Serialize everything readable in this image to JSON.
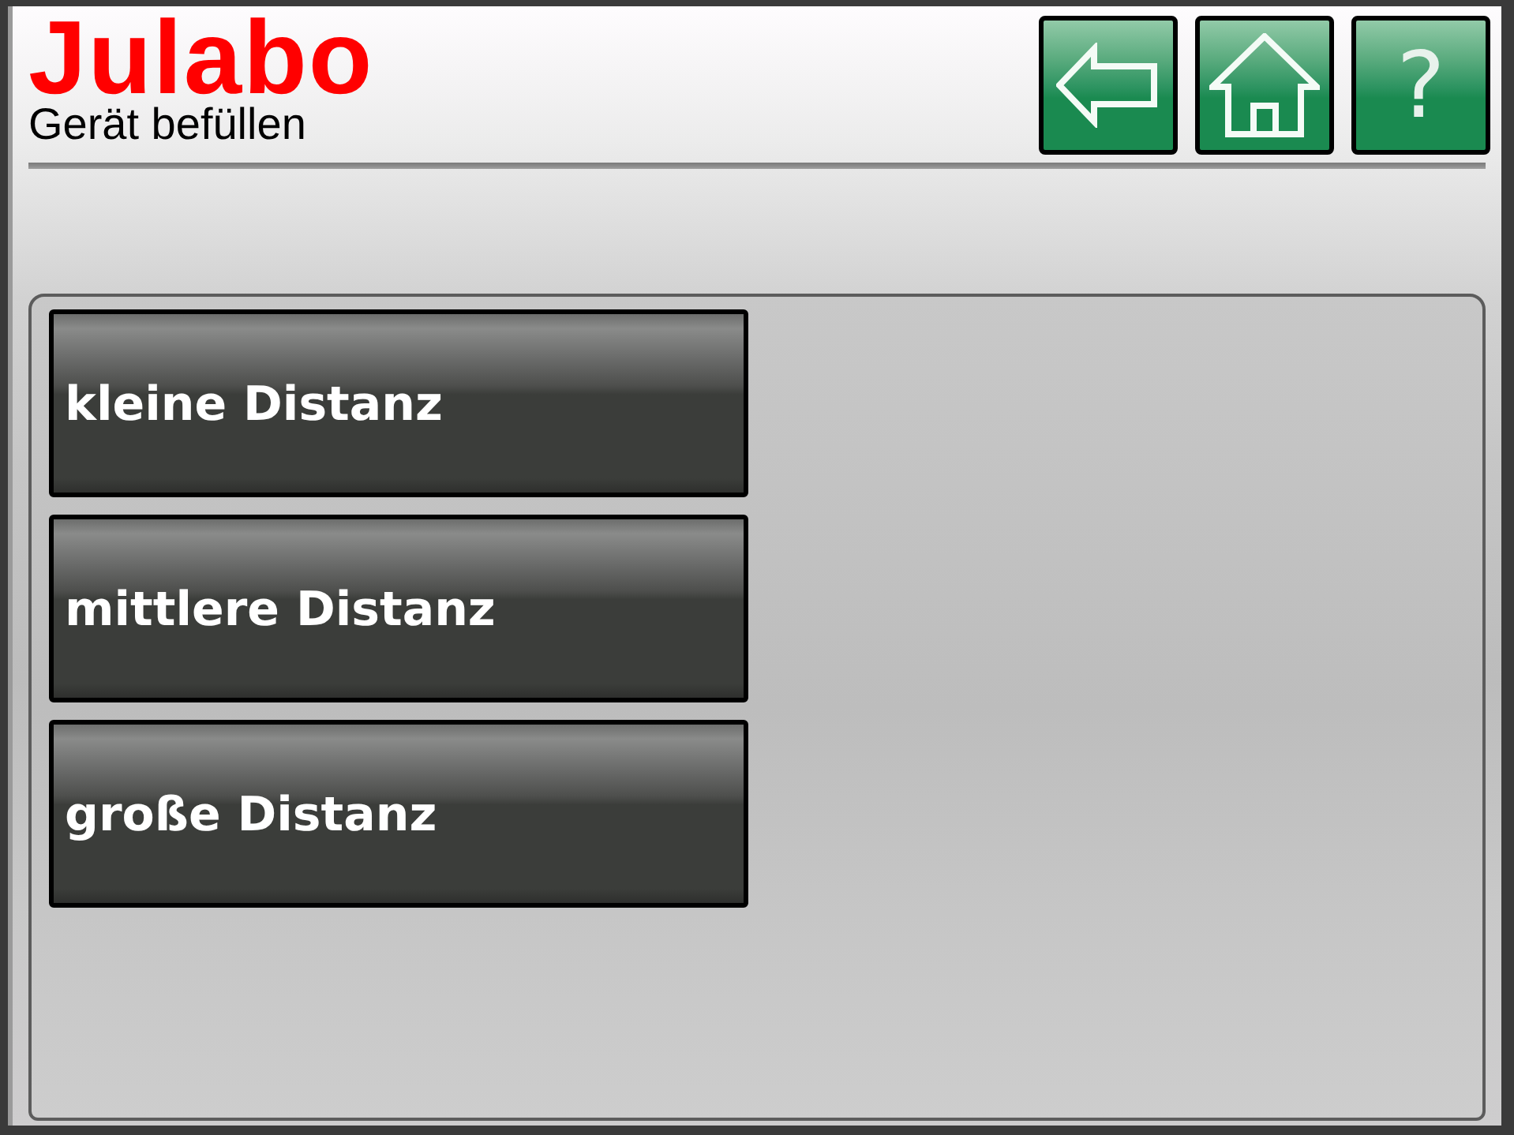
{
  "header": {
    "logo": "Julabo",
    "title": "Gerät befüllen"
  },
  "toolbar": [
    {
      "kind": "back"
    },
    {
      "kind": "home"
    },
    {
      "kind": "help",
      "glyph": "?"
    }
  ],
  "options": [
    {
      "label": "kleine Distanz"
    },
    {
      "label": "mittlere Distanz"
    },
    {
      "label": "große Distanz"
    }
  ]
}
